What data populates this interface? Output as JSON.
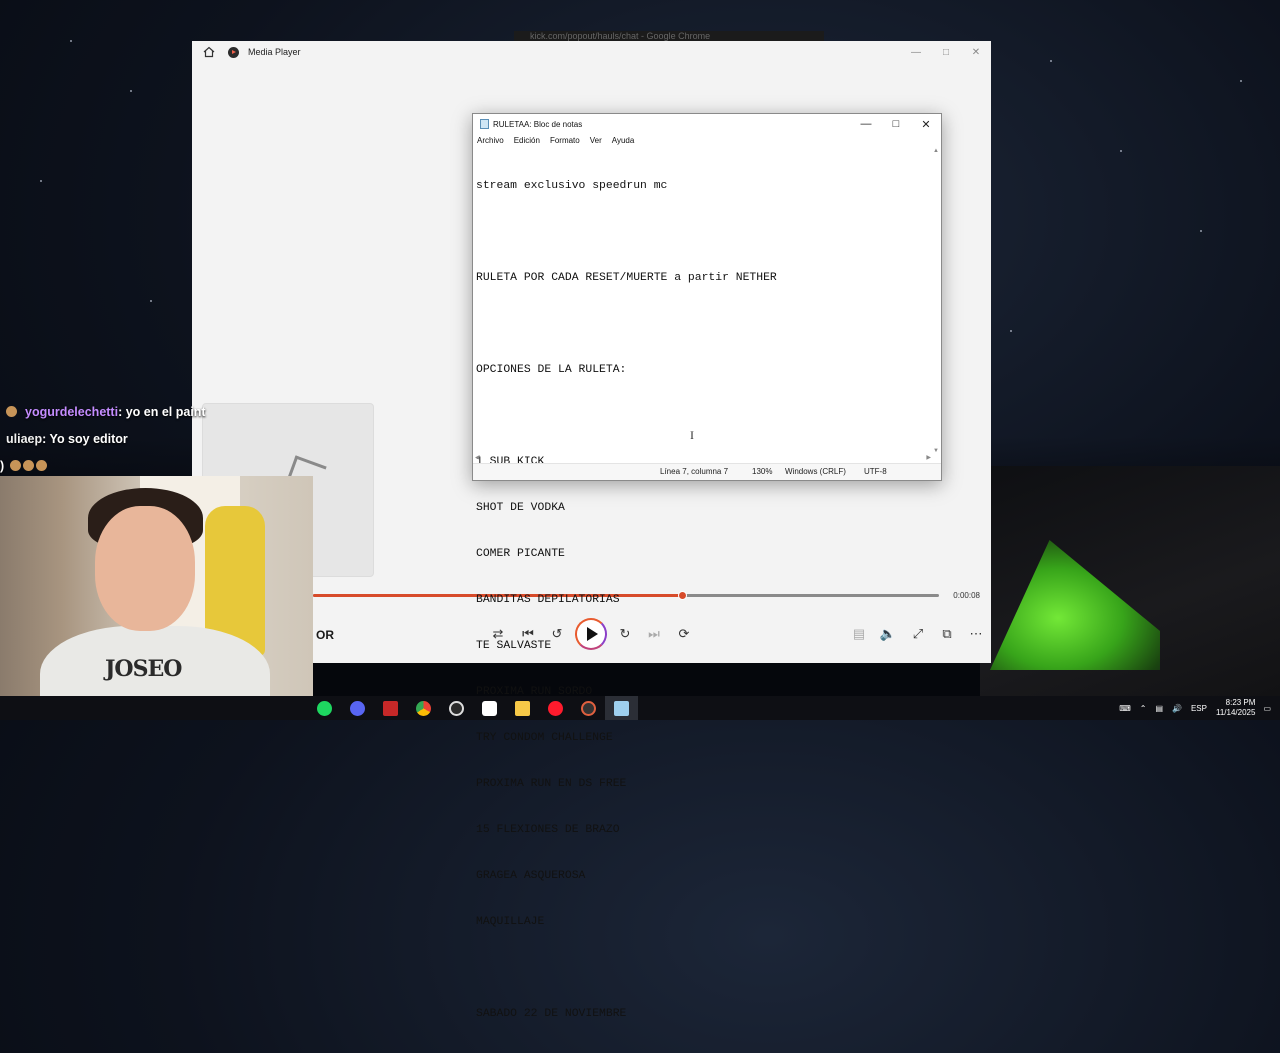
{
  "background_browser": {
    "title": "kick.com/popout/hauls/chat - Google Chrome"
  },
  "media_player": {
    "title": "Media Player",
    "current_time": "0:00:08",
    "progress_fraction": 0.59,
    "media_name": "OR"
  },
  "notepad": {
    "title": "RULETAA: Bloc de notas",
    "menu": [
      "Archivo",
      "Edición",
      "Formato",
      "Ver",
      "Ayuda"
    ],
    "lines": [
      "stream exclusivo speedrun mc",
      "",
      "RULETA POR CADA RESET/MUERTE a partir NETHER",
      "",
      "OPCIONES DE LA RULETA:",
      "",
      "1 SUB KICK",
      "SHOT DE VODKA",
      "COMER PICANTE",
      "BANDITAS DEPILATORIAS",
      "TE SALVASTE",
      "PROXIMA RUN SORDO",
      "TRY CONDOM CHALLENGE",
      "PROXIMA RUN EN DS FREE",
      "15 FLEXIONES DE BRAZO",
      "GRAGEA ASQUEROSA",
      "MAQUILLAJE",
      "",
      "SABADO 22 DE NOVIEMBRE"
    ],
    "status": {
      "position": "Línea 7, columna 7",
      "zoom": "130%",
      "line_ending": "Windows (CRLF)",
      "encoding": "UTF-8"
    }
  },
  "chat": {
    "messages": [
      {
        "user": "yogurdelechetti",
        "text": " : yo en el paint"
      },
      {
        "user": "uliaep",
        "text": " : Yo soy editor"
      }
    ]
  },
  "webcam": {
    "shirt_print": "JOSEO"
  },
  "taskbar": {
    "language": "ESP",
    "time": "8:23 PM",
    "date": "11/14/2025",
    "apps": [
      "spotify-icon",
      "discord-icon",
      "voice-meeter-icon",
      "chrome-icon",
      "obs-icon",
      "capcut-icon",
      "file-explorer-icon",
      "opera-icon",
      "media-player-icon",
      "notepad-icon"
    ]
  },
  "colors": {
    "accent": "#d74b2a",
    "chat_user": "#c48cff"
  }
}
